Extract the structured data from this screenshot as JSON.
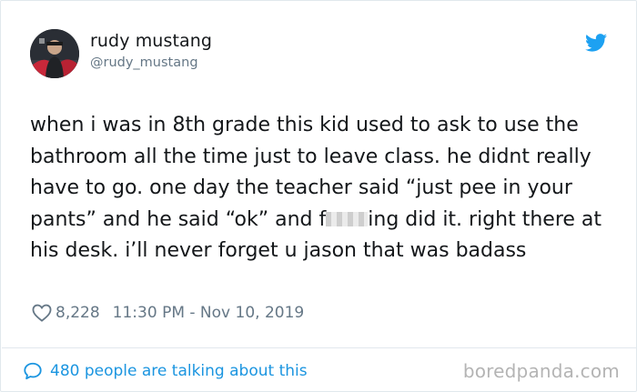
{
  "author": {
    "name": "rudy mustang",
    "handle": "@rudy_mustang",
    "avatar_icon": "profile-photo",
    "brand_icon": "twitter-bird-icon",
    "brand_color": "#1da1f2"
  },
  "tweet": {
    "text_part1": "when i was in 8th grade this kid used to ask to use the bathroom all the time just to leave class. he didnt really have to go. one day the teacher said “just pee in your pants” and he said “ok” and f",
    "text_part2": "ing did it. right there at his desk. i’ll never forget u jason that was badass"
  },
  "meta": {
    "likes": "8,228",
    "timestamp": "11:30 PM - Nov 10, 2019"
  },
  "footer": {
    "talking_text": "480 people are talking about this",
    "link_color": "#1b95e0"
  },
  "watermark": "boredpanda.com"
}
